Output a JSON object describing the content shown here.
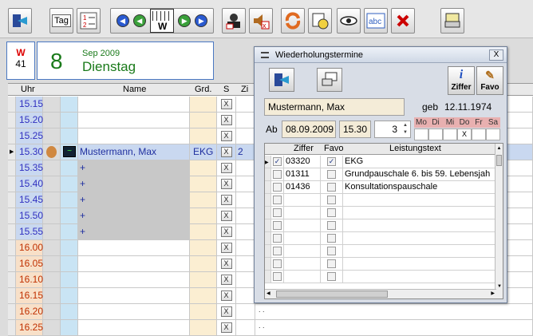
{
  "toolbar": {
    "tag_label": "Tag",
    "woche_letter": "W"
  },
  "header": {
    "week_letter": "W",
    "week_number": "41",
    "day": "8",
    "month_year": "Sep 2009",
    "weekday": "Dienstag"
  },
  "grid": {
    "columns": {
      "time": "Uhr",
      "name": "Name",
      "grd": "Grd.",
      "s": "S",
      "zi": "Zi"
    },
    "rows": [
      {
        "time": "15.15",
        "name": "",
        "grd": "",
        "zi": "",
        "color": "#3030c0",
        "bg": "#ffffff"
      },
      {
        "time": "15.20",
        "name": "",
        "grd": "",
        "zi": "",
        "color": "#3030c0",
        "bg": "#ffffff"
      },
      {
        "time": "15.25",
        "name": "",
        "grd": "",
        "zi": "",
        "color": "#3030c0",
        "bg": "#ffffff"
      },
      {
        "time": "15.30",
        "name": "Mustermann, Max",
        "grd": "EKG",
        "zi": "2",
        "color": "#3030c0",
        "bg": "#c9d8f0",
        "selected": true
      },
      {
        "time": "15.35",
        "name": "+",
        "grd": "",
        "zi": "",
        "color": "#3030c0",
        "bg": "#c8c8c8"
      },
      {
        "time": "15.40",
        "name": "+",
        "grd": "",
        "zi": "",
        "color": "#3030c0",
        "bg": "#c8c8c8"
      },
      {
        "time": "15.45",
        "name": "+",
        "grd": "",
        "zi": "",
        "color": "#3030c0",
        "bg": "#c8c8c8"
      },
      {
        "time": "15.50",
        "name": "+",
        "grd": "",
        "zi": "",
        "color": "#3030c0",
        "bg": "#c8c8c8"
      },
      {
        "time": "15.55",
        "name": "+",
        "grd": "",
        "zi": "",
        "color": "#3030c0",
        "bg": "#c8c8c8"
      },
      {
        "time": "16.00",
        "name": "",
        "grd": "",
        "zi": "",
        "color": "#c03000",
        "bg": "#ffffff"
      },
      {
        "time": "16.05",
        "name": "",
        "grd": "",
        "zi": "",
        "color": "#c03000",
        "bg": "#ffffff"
      },
      {
        "time": "16.10",
        "name": "",
        "grd": "",
        "zi": "",
        "color": "#c03000",
        "bg": "#ffffff"
      },
      {
        "time": "16.15",
        "name": "",
        "grd": "",
        "zi": "",
        "color": "#c03000",
        "bg": "#ffffff"
      },
      {
        "time": "16.20",
        "name": "",
        "grd": "",
        "zi": "",
        "color": "#c03000",
        "bg": "#ffffff"
      },
      {
        "time": "16.25",
        "name": "",
        "grd": "",
        "zi": "",
        "color": "#c03000",
        "bg": "#ffffff"
      }
    ],
    "s_button": "X",
    "rest_dots": ". ."
  },
  "dialog": {
    "title": "Wiederholungstermine",
    "close": "X",
    "ziffer_label": "Ziffer",
    "favo_label": "Favo",
    "patient_name": "Mustermann, Max",
    "geb_label": "geb",
    "birthdate": "12.11.1974",
    "ab_label": "Ab",
    "start_date": "08.09.2009",
    "start_time": "15.30",
    "count": "3",
    "weekdays": [
      "Mo",
      "Di",
      "Mi",
      "Do",
      "Fr",
      "Sa"
    ],
    "weekday_marks": [
      "",
      "",
      "",
      "X",
      "",
      ""
    ],
    "table": {
      "col_ziffer": "Ziffer",
      "col_favo": "Favo",
      "col_text": "Leistungstext",
      "rows": [
        {
          "ziffer": "03320",
          "favo": true,
          "checked": true,
          "text": "EKG"
        },
        {
          "ziffer": "01311",
          "favo": false,
          "checked": false,
          "text": "Grundpauschale 6. bis 59. Lebensjah"
        },
        {
          "ziffer": "01436",
          "favo": false,
          "checked": false,
          "text": "Konsultationspauschale"
        },
        {
          "ziffer": "",
          "favo": false,
          "checked": false,
          "text": ""
        },
        {
          "ziffer": "",
          "favo": false,
          "checked": false,
          "text": ""
        },
        {
          "ziffer": "",
          "favo": false,
          "checked": false,
          "text": ""
        },
        {
          "ziffer": "",
          "favo": false,
          "checked": false,
          "text": ""
        },
        {
          "ziffer": "",
          "favo": false,
          "checked": false,
          "text": ""
        },
        {
          "ziffer": "",
          "favo": false,
          "checked": false,
          "text": ""
        },
        {
          "ziffer": "",
          "favo": false,
          "checked": false,
          "text": ""
        }
      ]
    }
  }
}
